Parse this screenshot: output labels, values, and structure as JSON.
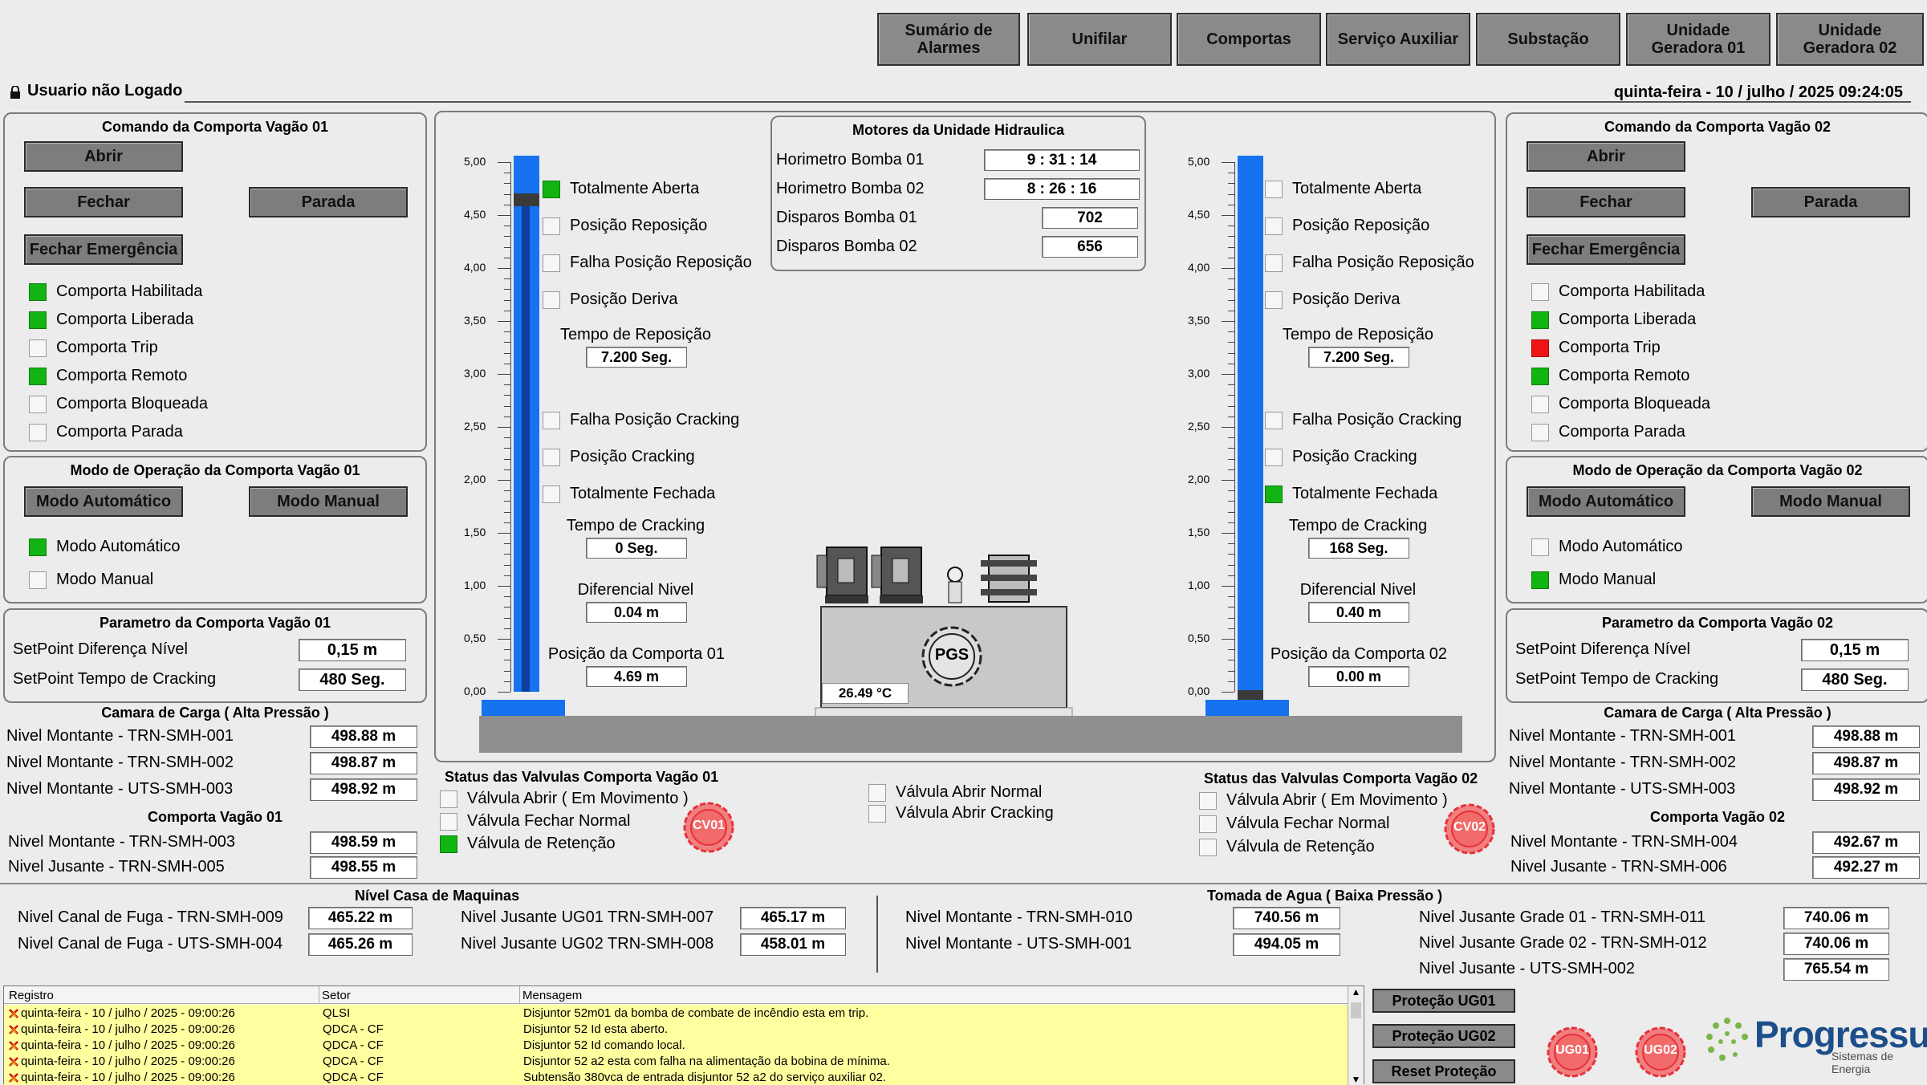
{
  "nav": [
    "Sumário de\nAlarmes",
    "Unifilar",
    "Comportas",
    "Serviço Auxiliar",
    "Substação",
    "Unidade\nGeradora 01",
    "Unidade\nGeradora 02"
  ],
  "user": "Usuario não Logado",
  "datetime": "quinta-feira - 10 / julho / 2025 09:24:05",
  "left": {
    "cmd_title": "Comando da Comporta Vagão 01",
    "btn_open": "Abrir",
    "btn_close": "Fechar",
    "btn_stop": "Parada",
    "btn_emerg": "Fechar Emergência",
    "status": [
      {
        "label": "Comporta Habilitada",
        "state": "green"
      },
      {
        "label": "Comporta Liberada",
        "state": "green"
      },
      {
        "label": "Comporta Trip",
        "state": "off"
      },
      {
        "label": "Comporta Remoto",
        "state": "green"
      },
      {
        "label": "Comporta Bloqueada",
        "state": "off"
      },
      {
        "label": "Comporta Parada",
        "state": "off"
      }
    ],
    "mode_title": "Modo de Operação da Comporta Vagão 01",
    "btn_auto": "Modo Automático",
    "btn_manual": "Modo Manual",
    "mode_ind": [
      {
        "label": "Modo Automático",
        "state": "green"
      },
      {
        "label": "Modo Manual",
        "state": "off"
      }
    ],
    "param_title": "Parametro da Comporta Vagão 01",
    "sp_diff_label": "SetPoint Diferença Nível",
    "sp_diff": "0,15 m",
    "sp_crack_label": "SetPoint Tempo de Cracking",
    "sp_crack": "480 Seg.",
    "camara_title": "Camara de Carga ( Alta Pressão )",
    "camara": [
      {
        "label": "Nivel Montante - TRN-SMH-001",
        "value": "498.88 m"
      },
      {
        "label": "Nivel Montante - TRN-SMH-002",
        "value": "498.87 m"
      },
      {
        "label": "Nivel Montante - UTS-SMH-003",
        "value": "498.92 m"
      }
    ],
    "comp_title": "Comporta Vagão 01",
    "comp": [
      {
        "label": "Nivel Montante - TRN-SMH-003",
        "value": "498.59 m"
      },
      {
        "label": "Nivel Jusante - TRN-SMH-005",
        "value": "498.55 m"
      }
    ]
  },
  "right": {
    "cmd_title": "Comando da Comporta Vagão 02",
    "btn_open": "Abrir",
    "btn_close": "Fechar",
    "btn_stop": "Parada",
    "btn_emerg": "Fechar Emergência",
    "status": [
      {
        "label": "Comporta Habilitada",
        "state": "off"
      },
      {
        "label": "Comporta Liberada",
        "state": "green"
      },
      {
        "label": "Comporta Trip",
        "state": "red"
      },
      {
        "label": "Comporta Remoto",
        "state": "green"
      },
      {
        "label": "Comporta Bloqueada",
        "state": "off"
      },
      {
        "label": "Comporta Parada",
        "state": "off"
      }
    ],
    "mode_title": "Modo de Operação da Comporta Vagão 02",
    "btn_auto": "Modo Automático",
    "btn_manual": "Modo Manual",
    "mode_ind": [
      {
        "label": "Modo Automático",
        "state": "off"
      },
      {
        "label": "Modo Manual",
        "state": "green"
      }
    ],
    "param_title": "Parametro da Comporta Vagão 02",
    "sp_diff_label": "SetPoint Diferença Nível",
    "sp_diff": "0,15 m",
    "sp_crack_label": "SetPoint Tempo de Cracking",
    "sp_crack": "480 Seg.",
    "camara_title": "Camara de Carga ( Alta Pressão )",
    "camara": [
      {
        "label": "Nivel Montante - TRN-SMH-001",
        "value": "498.88 m"
      },
      {
        "label": "Nivel Montante - TRN-SMH-002",
        "value": "498.87 m"
      },
      {
        "label": "Nivel Montante - UTS-SMH-003",
        "value": "498.92 m"
      }
    ],
    "comp_title": "Comporta Vagão 02",
    "comp": [
      {
        "label": "Nivel Montante - TRN-SMH-004",
        "value": "492.67 m"
      },
      {
        "label": "Nivel Jusante - TRN-SMH-006",
        "value": "492.27 m"
      }
    ]
  },
  "scale_ticks": [
    "5,00",
    "4,50",
    "4,00",
    "3,50",
    "3,00",
    "2,50",
    "2,00",
    "1,50",
    "1,00",
    "0,50",
    "0,00"
  ],
  "gate1": {
    "position_m": 4.69,
    "ind": [
      {
        "label": "Totalmente Aberta",
        "state": "green"
      },
      {
        "label": "Posição Reposição",
        "state": "off"
      },
      {
        "label": "Falha Posição Reposição",
        "state": "off"
      },
      {
        "label": "Posição Deriva",
        "state": "off"
      }
    ],
    "t_rep_label": "Tempo de Reposição",
    "t_rep": "7.200 Seg.",
    "ind2": [
      {
        "label": "Falha Posição Cracking",
        "state": "off"
      },
      {
        "label": "Posição Cracking",
        "state": "off"
      },
      {
        "label": "Totalmente Fechada",
        "state": "off"
      }
    ],
    "t_crack_label": "Tempo de Cracking",
    "t_crack": "0 Seg.",
    "diff_label": "Diferencial Nivel",
    "diff": "0.04 m",
    "pos_label": "Posição da Comporta 01",
    "pos": "4.69 m"
  },
  "gate2": {
    "position_m": 0.0,
    "ind": [
      {
        "label": "Totalmente Aberta",
        "state": "off"
      },
      {
        "label": "Posição Reposição",
        "state": "off"
      },
      {
        "label": "Falha Posição Reposição",
        "state": "off"
      },
      {
        "label": "Posição Deriva",
        "state": "off"
      }
    ],
    "t_rep_label": "Tempo de Reposição",
    "t_rep": "7.200 Seg.",
    "ind2": [
      {
        "label": "Falha Posição Cracking",
        "state": "off"
      },
      {
        "label": "Posição Cracking",
        "state": "off"
      },
      {
        "label": "Totalmente Fechada",
        "state": "green"
      }
    ],
    "t_crack_label": "Tempo de Cracking",
    "t_crack": "168 Seg.",
    "diff_label": "Diferencial Nivel",
    "diff": "0.40 m",
    "pos_label": "Posição da Comporta 02",
    "pos": "0.00 m"
  },
  "motors": {
    "title": "Motores da Unidade Hidraulica",
    "rows": [
      {
        "label": "Horimetro Bomba 01",
        "value": "9 : 31 : 14"
      },
      {
        "label": "Horimetro Bomba 02",
        "value": "8 : 26 : 16"
      },
      {
        "label": "Disparos Bomba 01",
        "value": "702"
      },
      {
        "label": "Disparos Bomba 02",
        "value": "656"
      }
    ]
  },
  "hpu": {
    "logo": "PGS",
    "temp": "26.49 °C"
  },
  "valves1": {
    "title": "Status das Valvulas  Comporta Vagão 01",
    "items": [
      {
        "label": "Válvula Abrir ( Em Movimento )",
        "state": "off"
      },
      {
        "label": "Válvula Fechar Normal",
        "state": "off"
      },
      {
        "label": "Válvula de Retenção",
        "state": "green"
      }
    ],
    "badge": "CV01"
  },
  "valves_mid": {
    "items": [
      {
        "label": "Válvula Abrir Normal",
        "state": "off"
      },
      {
        "label": "Válvula Abrir Cracking",
        "state": "off"
      }
    ]
  },
  "valves2": {
    "title": "Status das Valvulas  Comporta Vagão 02",
    "items": [
      {
        "label": "Válvula Abrir ( Em Movimento )",
        "state": "off"
      },
      {
        "label": "Válvula Fechar Normal",
        "state": "off"
      },
      {
        "label": "Válvula de Retenção",
        "state": "off"
      }
    ],
    "badge": "CV02"
  },
  "casa": {
    "title": "Nível Casa de Maquinas",
    "rows": [
      {
        "label": "Nivel Canal de Fuga - TRN-SMH-009",
        "value": "465.22 m"
      },
      {
        "label": "Nivel Canal de Fuga - UTS-SMH-004",
        "value": "465.26 m"
      }
    ],
    "rows2": [
      {
        "label": "Nivel Jusante UG01 TRN-SMH-007",
        "value": "465.17 m"
      },
      {
        "label": "Nivel Jusante UG02 TRN-SMH-008",
        "value": "458.01 m"
      }
    ]
  },
  "tomada": {
    "title": "Tomada de Agua ( Baixa Pressão )",
    "rows": [
      {
        "label": "Nivel Montante - TRN-SMH-010",
        "value": "740.56 m"
      },
      {
        "label": "Nivel Montante - UTS-SMH-001",
        "value": "494.05 m"
      }
    ],
    "rows2": [
      {
        "label": "Nivel Jusante Grade 01 - TRN-SMH-011",
        "value": "740.06 m"
      },
      {
        "label": "Nivel Jusante Grade 02 - TRN-SMH-012",
        "value": "740.06 m"
      },
      {
        "label": "Nivel Jusante - UTS-SMH-002",
        "value": "765.54 m"
      }
    ]
  },
  "log": {
    "headers": [
      "Registro",
      "Setor",
      "Mensagem"
    ],
    "rows": [
      {
        "time": "quinta-feira - 10 / julho / 2025 - 09:00:26",
        "sector": "QLSI",
        "msg": "Disjuntor 52m01 da bomba de combate de incêndio esta em trip."
      },
      {
        "time": "quinta-feira - 10 / julho / 2025 - 09:00:26",
        "sector": "QDCA - CF",
        "msg": "Disjuntor 52 Id esta aberto."
      },
      {
        "time": "quinta-feira - 10 / julho / 2025 - 09:00:26",
        "sector": "QDCA - CF",
        "msg": "Disjuntor 52 Id comando local."
      },
      {
        "time": "quinta-feira - 10 / julho / 2025 - 09:00:26",
        "sector": "QDCA - CF",
        "msg": "Disjuntor 52 a2 esta com falha na alimentação da bobina de mínima."
      },
      {
        "time": "quinta-feira - 10 / julho / 2025 - 09:00:26",
        "sector": "QDCA - CF",
        "msg": "Subtensão 380vca de entrada disjuntor 52 a2 do serviço auxiliar 02."
      }
    ]
  },
  "bottom_btns": [
    "Proteção UG01",
    "Proteção UG02",
    "Reset Proteção"
  ],
  "badges": [
    "UG01",
    "UG02"
  ],
  "brand": {
    "name": "Progressul",
    "sub": "Sistemas de Energia"
  }
}
